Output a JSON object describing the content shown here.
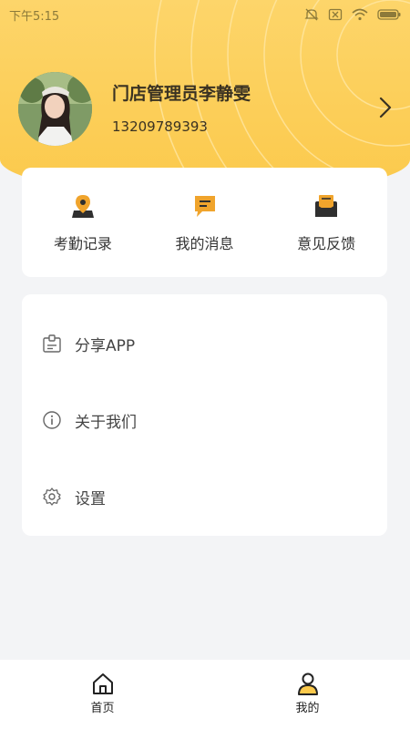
{
  "status_bar": {
    "time": "下午5:15",
    "icons": [
      "mute-icon",
      "no-sim-icon",
      "wifi-icon",
      "battery-icon"
    ]
  },
  "profile": {
    "name": "门店管理员李静雯",
    "phone": "13209789393"
  },
  "quick_actions": [
    {
      "label": "考勤记录",
      "icon": "location-pin-icon"
    },
    {
      "label": "我的消息",
      "icon": "message-icon"
    },
    {
      "label": "意见反馈",
      "icon": "feedback-icon"
    }
  ],
  "menu": [
    {
      "label": "分享APP",
      "icon": "share-app-icon"
    },
    {
      "label": "关于我们",
      "icon": "info-icon"
    },
    {
      "label": "设置",
      "icon": "gear-icon"
    }
  ],
  "tabbar": {
    "home_label": "首页",
    "mine_label": "我的"
  },
  "colors": {
    "accent": "#fbc94b",
    "icon_dark": "#2f2f2f",
    "icon_orange": "#f0a42c"
  }
}
